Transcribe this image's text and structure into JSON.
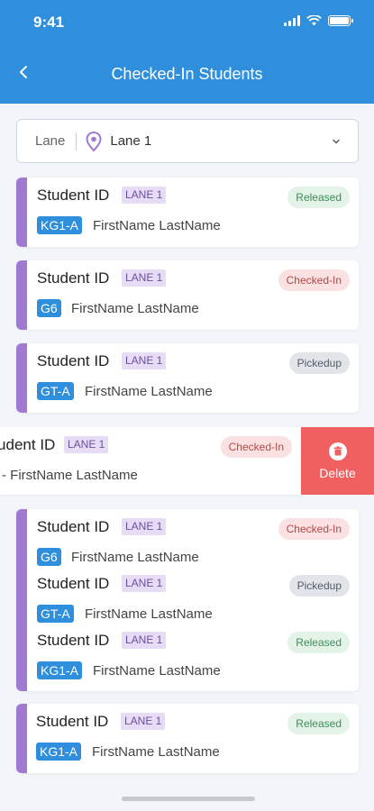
{
  "status": {
    "time": "9:41"
  },
  "header": {
    "title": "Checked-In Students"
  },
  "filter": {
    "label": "Lane",
    "value": "Lane 1"
  },
  "delete_label": "Delete",
  "colors": {
    "primary": "#2f8fdc",
    "accent_bar": "#a07ad0",
    "delete": "#f06060"
  },
  "cards": [
    {
      "rows": [
        {
          "student_id": "Student ID",
          "lane": "LANE 1",
          "grade": "KG1-A",
          "name": "FirstName LastName",
          "status": "Released"
        }
      ]
    },
    {
      "rows": [
        {
          "student_id": "Student ID",
          "lane": "LANE 1",
          "grade": "G6",
          "name": "FirstName LastName",
          "status": "Checked-In"
        }
      ]
    },
    {
      "rows": [
        {
          "student_id": "Student ID",
          "lane": "LANE 1",
          "grade": "GT-A",
          "name": "FirstName LastName",
          "status": "Pickedup"
        }
      ]
    },
    {
      "rows": [
        {
          "student_id": "Student ID",
          "lane": "LANE 1",
          "grade": "",
          "name": "- FirstName LastName",
          "status": "Checked-In"
        }
      ]
    },
    {
      "rows": [
        {
          "student_id": "Student ID",
          "lane": "LANE 1",
          "grade": "G6",
          "name": "FirstName LastName",
          "status": "Checked-In"
        },
        {
          "student_id": "Student ID",
          "lane": "LANE 1",
          "grade": "GT-A",
          "name": "FirstName LastName",
          "status": "Pickedup"
        },
        {
          "student_id": "Student ID",
          "lane": "LANE 1",
          "grade": "KG1-A",
          "name": "FirstName LastName",
          "status": "Released"
        }
      ]
    },
    {
      "rows": [
        {
          "student_id": "Student ID",
          "lane": "LANE 1",
          "grade": "KG1-A",
          "name": "FirstName LastName",
          "status": "Released"
        }
      ]
    }
  ]
}
